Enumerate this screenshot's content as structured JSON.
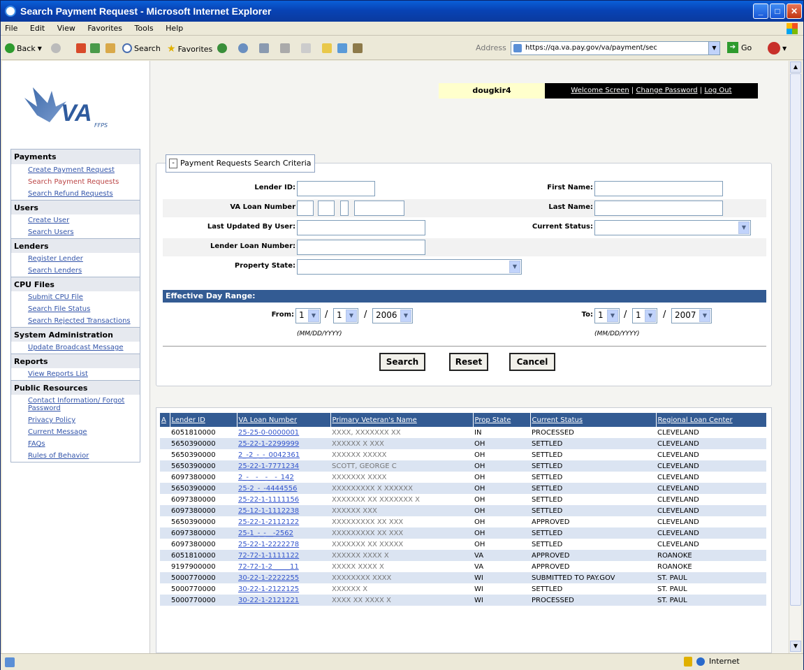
{
  "window": {
    "title": "Search Payment Request - Microsoft Internet Explorer"
  },
  "menu": [
    "File",
    "Edit",
    "View",
    "Favorites",
    "Tools",
    "Help"
  ],
  "toolbar": {
    "back": "Back",
    "search": "Search",
    "favorites": "Favorites",
    "address_label": "Address",
    "address_value": "https://qa.va.pay.gov/va/payment/sec",
    "go": "Go"
  },
  "status": {
    "zone": "Internet"
  },
  "logo": {
    "text": "VA",
    "sub": "FFPS"
  },
  "sidebar": {
    "sections": [
      {
        "title": "Payments",
        "items": [
          "Create Payment Request",
          "Search Payment Requests",
          "Search Refund Requests"
        ]
      },
      {
        "title": "Users",
        "items": [
          "Create User",
          "Search Users"
        ]
      },
      {
        "title": "Lenders",
        "items": [
          "Register Lender",
          "Search Lenders"
        ]
      },
      {
        "title": "CPU Files",
        "items": [
          "Submit CPU File",
          "Search File Status",
          "Search Rejected Transactions"
        ]
      },
      {
        "title": "System Administration",
        "items": [
          "Update Broadcast Message"
        ]
      },
      {
        "title": "Reports",
        "items": [
          "View Reports List"
        ]
      },
      {
        "title": "Public Resources",
        "items": [
          "Contact Information/ Forgot Password",
          "Privacy Policy",
          "Current Message",
          "FAQs",
          "Rules of Behavior"
        ]
      }
    ]
  },
  "user": {
    "name": "dougkir4",
    "welcome": "Welcome Screen",
    "change_password": "Change Password",
    "logout": "Log Out"
  },
  "search": {
    "legend": "Payment Requests Search Criteria",
    "lender_id": "Lender ID:",
    "first_name": "First Name:",
    "va_loan_number": "VA Loan Number",
    "last_name": "Last Name:",
    "last_updated": "Last Updated By User:",
    "current_status": "Current Status:",
    "lender_loan_number": "Lender Loan Number:",
    "property_state": "Property State:",
    "range_title": "Effective Day Range:",
    "from": "From:",
    "to": "To:",
    "from_month": "1",
    "from_day": "1",
    "from_year": "2006",
    "to_month": "1",
    "to_day": "1",
    "to_year": "2007",
    "date_hint": "(MM/DD/YYYY)",
    "btn_search": "Search",
    "btn_reset": "Reset",
    "btn_cancel": "Cancel"
  },
  "results": {
    "headers": [
      "A",
      "Lender ID",
      "VA Loan Number",
      "Primary Veteran's Name",
      "Prop State",
      "Current Status",
      "Regional Loan Center"
    ],
    "rows": [
      [
        "6051810000",
        "25-25-0-0000001",
        "XXXX, XXXXXXX XX",
        "IN",
        "PROCESSED",
        "CLEVELAND"
      ],
      [
        "5650390000",
        "25-22-1-2299999",
        "XXXXXX X XXX",
        "OH",
        "SETTLED",
        "CLEVELAND"
      ],
      [
        "5650390000",
        "2_-2_-_-_0042361",
        "XXXXXX XXXXX",
        "OH",
        "SETTLED",
        "CLEVELAND"
      ],
      [
        "5650390000",
        "25-22-1-7771234",
        "SCOTT, GEORGE C",
        "OH",
        "SETTLED",
        "CLEVELAND"
      ],
      [
        "6097380000",
        "2_-__-__-__-_142",
        "XXXXXXX XXXX",
        "OH",
        "SETTLED",
        "CLEVELAND"
      ],
      [
        "5650390000",
        "25-2_-_-4444556",
        "XXXXXXXXX X XXXXXX",
        "OH",
        "SETTLED",
        "CLEVELAND"
      ],
      [
        "6097380000",
        "25-22-1-1111156",
        "XXXXXXX XX XXXXXXX X",
        "OH",
        "SETTLED",
        "CLEVELAND"
      ],
      [
        "6097380000",
        "25-12-1-1112238",
        "XXXXXX XXX",
        "OH",
        "SETTLED",
        "CLEVELAND"
      ],
      [
        "5650390000",
        "25-22-1-2112122",
        "XXXXXXXXX XX XXX",
        "OH",
        "APPROVED",
        "CLEVELAND"
      ],
      [
        "6097380000",
        "25-1_-_-__-2562",
        "XXXXXXXXX XX XXX",
        "OH",
        "SETTLED",
        "CLEVELAND"
      ],
      [
        "6097380000",
        "25-22-1-2222278",
        "XXXXXXX XX XXXXX",
        "OH",
        "SETTLED",
        "CLEVELAND"
      ],
      [
        "6051810000",
        "72-72-1-1111122",
        "XXXXXX XXXX X",
        "VA",
        "APPROVED",
        "ROANOKE"
      ],
      [
        "9197900000",
        "72-72-1-2_____11",
        "XXXXX XXXX X",
        "VA",
        "APPROVED",
        "ROANOKE"
      ],
      [
        "5000770000",
        "30-22-1-2222255",
        "XXXXXXXX XXXX",
        "WI",
        "SUBMITTED TO PAY.GOV",
        "ST. PAUL"
      ],
      [
        "5000770000",
        "30-22-1-2122125",
        "XXXXXX X",
        "WI",
        "SETTLED",
        "ST. PAUL"
      ],
      [
        "5000770000",
        "30-22-1-2121221",
        "XXXX XX XXXX X",
        "WI",
        "PROCESSED",
        "ST. PAUL"
      ]
    ]
  }
}
